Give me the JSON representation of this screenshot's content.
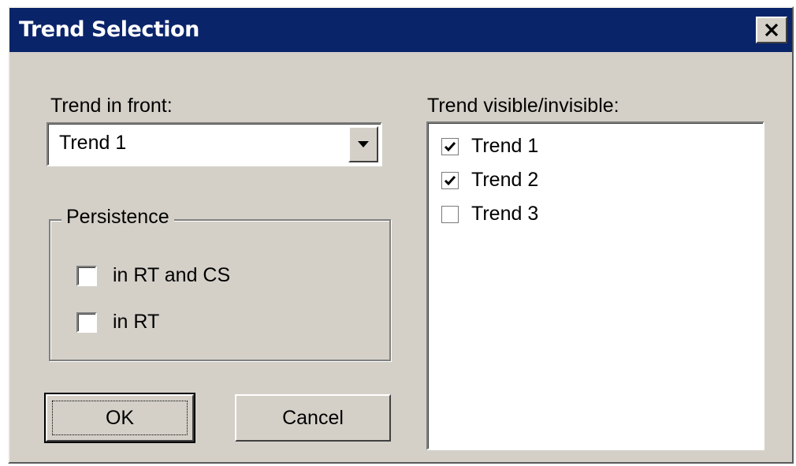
{
  "window": {
    "title": "Trend Selection",
    "close_icon": "close-x-icon"
  },
  "trend_in_front": {
    "label": "Trend in front:",
    "selected": "Trend 1",
    "dropdown_icon": "chevron-down-icon"
  },
  "persistence": {
    "label": "Persistence",
    "options": [
      {
        "label": "in RT and CS",
        "checked": false
      },
      {
        "label": "in RT",
        "checked": false
      }
    ]
  },
  "visibility": {
    "label": "Trend visible/invisible:",
    "items": [
      {
        "label": "Trend 1",
        "checked": true
      },
      {
        "label": "Trend 2",
        "checked": true
      },
      {
        "label": "Trend 3",
        "checked": false
      }
    ]
  },
  "buttons": {
    "ok": "OK",
    "cancel": "Cancel"
  },
  "colors": {
    "title_bar": "#0a246a",
    "dialog_face": "#d4d0c8"
  }
}
